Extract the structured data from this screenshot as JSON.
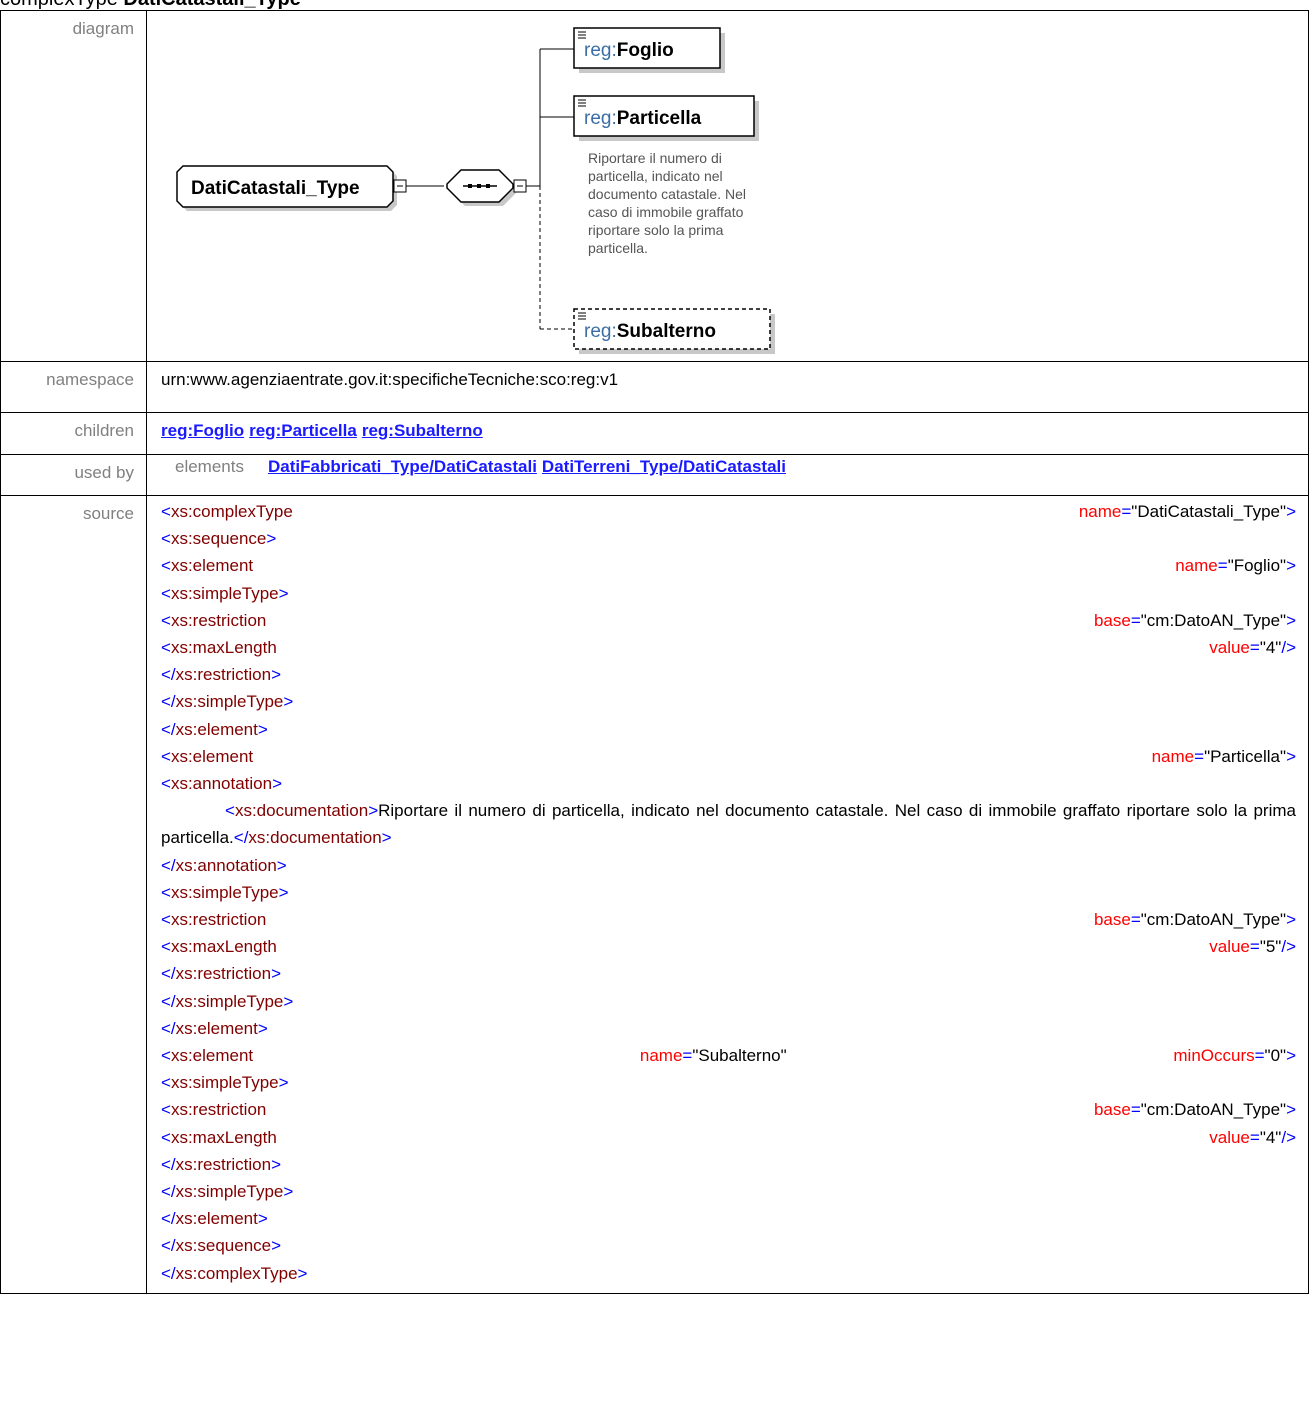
{
  "header": {
    "prefix": "complexType ",
    "name": "DatiCatastali_Type"
  },
  "labels": {
    "diagram": "diagram",
    "namespace": "namespace",
    "children": "children",
    "used_by": "used by",
    "source": "source"
  },
  "diagram": {
    "root": "DatiCatastali_Type",
    "children": [
      {
        "prefix": "reg:",
        "name": "Foglio"
      },
      {
        "prefix": "reg:",
        "name": "Particella"
      },
      {
        "prefix": "reg:",
        "name": "Subalterno"
      }
    ],
    "annotation_lines": [
      "Riportare il numero di",
      "particella, indicato nel",
      "documento catastale. Nel",
      "caso di immobile graffato",
      "riportare solo la prima",
      "particella."
    ]
  },
  "namespace": "urn:www.agenziaentrate.gov.it:specificheTecniche:sco:reg:v1",
  "children_links": [
    "reg:Foglio",
    "reg:Particella",
    "reg:Subalterno"
  ],
  "used_by": {
    "kind": "elements",
    "links": [
      "DatiFabbricati_Type/DatiCatastali",
      "DatiTerreni_Type/DatiCatastali"
    ]
  },
  "source": {
    "l1_tag": "xs:complexType",
    "l1_attr": "name",
    "l1_val": "\"DatiCatastali_Type\"",
    "l2_tag": "xs:sequence",
    "l3_tag": "xs:element",
    "l3_attr": "name",
    "l3_val": "\"Foglio\"",
    "l4_tag": "xs:simpleType",
    "l5_tag": "xs:restriction",
    "l5_attr": "base",
    "l5_val": "\"cm:DatoAN_Type\"",
    "l6_tag": "xs:maxLength",
    "l6_attr": "value",
    "l6_val": "\"4\"",
    "l7_tag": "xs:restriction",
    "l8_tag": "xs:simpleType",
    "l9_tag": "xs:element",
    "l10_tag": "xs:element",
    "l10_attr": "name",
    "l10_val": "\"Particella\"",
    "l11_tag": "xs:annotation",
    "l12_tag": "xs:documentation",
    "doc_text": "Riportare il numero di particella, indicato nel documento catastale. Nel caso di immobile graffato riportare solo la prima particella.",
    "l12_close": "xs:documentation",
    "l14_tag": "xs:annotation",
    "l15_tag": "xs:simpleType",
    "l16_tag": "xs:restriction",
    "l16_attr": "base",
    "l16_val": "\"cm:DatoAN_Type\"",
    "l17_tag": "xs:maxLength",
    "l17_attr": "value",
    "l17_val": "\"5\"",
    "l18_tag": "xs:restriction",
    "l19_tag": "xs:simpleType",
    "l20_tag": "xs:element",
    "l21_tag": "xs:element",
    "l21_attr1": "name",
    "l21_val1": "\"Subalterno\"",
    "l21_attr2": "minOccurs",
    "l21_val2": "\"0\"",
    "l22_tag": "xs:simpleType",
    "l23_tag": "xs:restriction",
    "l23_attr": "base",
    "l23_val": "\"cm:DatoAN_Type\"",
    "l24_tag": "xs:maxLength",
    "l24_attr": "value",
    "l24_val": "\"4\"",
    "l25_tag": "xs:restriction",
    "l26_tag": "xs:simpleType",
    "l27_tag": "xs:element",
    "l28_tag": "xs:sequence",
    "l29_tag": "xs:complexType"
  }
}
